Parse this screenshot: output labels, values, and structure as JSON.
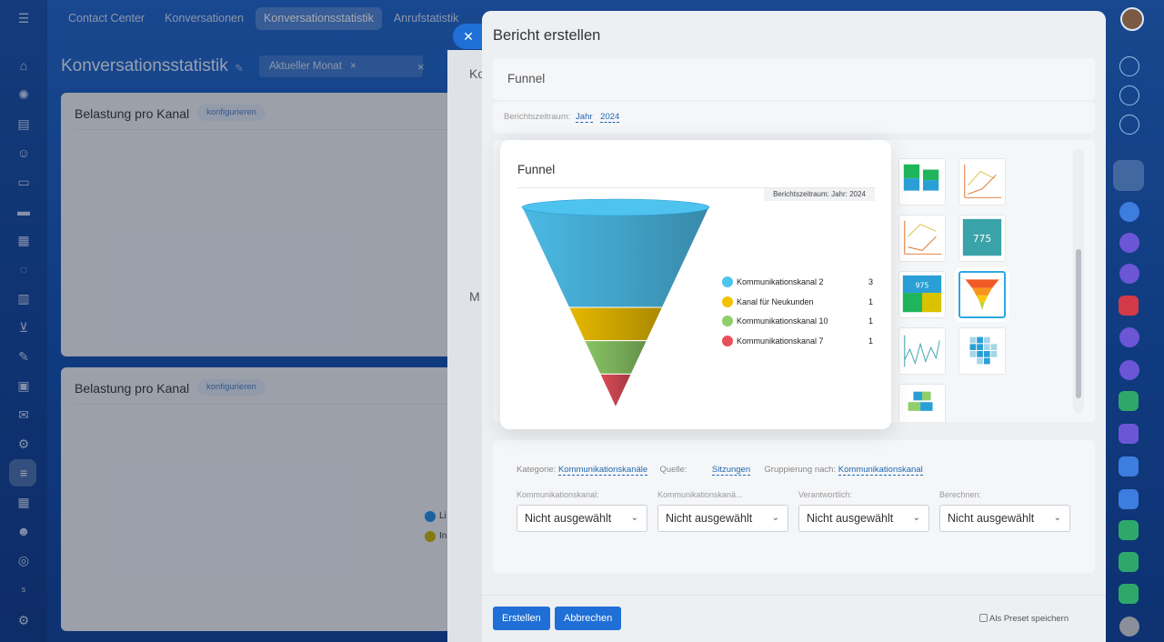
{
  "app": {
    "topnav": [
      "Contact Center",
      "Konversationen",
      "Konversationsstatistik",
      "Anrufstatistik"
    ],
    "active_tab_index": 2,
    "page_title": "Konversationsstatistik",
    "filter_chip": "Aktueller Monat",
    "cards": [
      {
        "title": "Belastung pro Kanal",
        "badge": "konfigurieren"
      },
      {
        "title": "Belastung pro Kanal",
        "badge": "konfigurieren"
      }
    ],
    "legend_fragments": [
      "Li",
      "In"
    ],
    "behind_panel_letters": [
      "Ko",
      "M"
    ]
  },
  "modal": {
    "title": "Bericht erstellen",
    "name_value": "Funnel",
    "period_label": "Berichtszeitraum:",
    "period_type": "Jahr",
    "period_year": "2024",
    "preview": {
      "title": "Funnel",
      "period_badge": "Berichtszeitraum: Jahr: 2024",
      "thumb_numbers": [
        "775",
        "975"
      ]
    },
    "meta": {
      "category_label": "Kategorie:",
      "category_value": "Kommunikationskanäle",
      "source_label": "Quelle:",
      "source_value": "Sitzungen",
      "grouping_label": "Gruppierung nach:",
      "grouping_value": "Kommunikationskanal"
    },
    "dropdowns": [
      {
        "label": "Kommunikationskanal:",
        "value": "Nicht ausgewählt"
      },
      {
        "label": "Kommunikationskanä...",
        "value": "Nicht ausgewählt"
      },
      {
        "label": "Verantwortlich:",
        "value": "Nicht ausgewählt"
      },
      {
        "label": "Berechnen:",
        "value": "Nicht ausgewählt"
      }
    ],
    "buttons": {
      "create": "Erstellen",
      "cancel": "Abbrechen"
    },
    "preset_label": "Als Preset speichern"
  },
  "chart_data": {
    "type": "funnel",
    "title": "Funnel",
    "subtitle": "Berichtszeitraum: Jahr: 2024",
    "series": [
      {
        "name": "Kommunikationskanal 2",
        "value": 3,
        "color": "#4fc3f0"
      },
      {
        "name": "Kanal für Neukunden",
        "value": 1,
        "color": "#f2c200"
      },
      {
        "name": "Kommunikationskanal 10",
        "value": 1,
        "color": "#8fce6a"
      },
      {
        "name": "Kommunikationskanal 7",
        "value": 1,
        "color": "#e8505b"
      }
    ]
  }
}
